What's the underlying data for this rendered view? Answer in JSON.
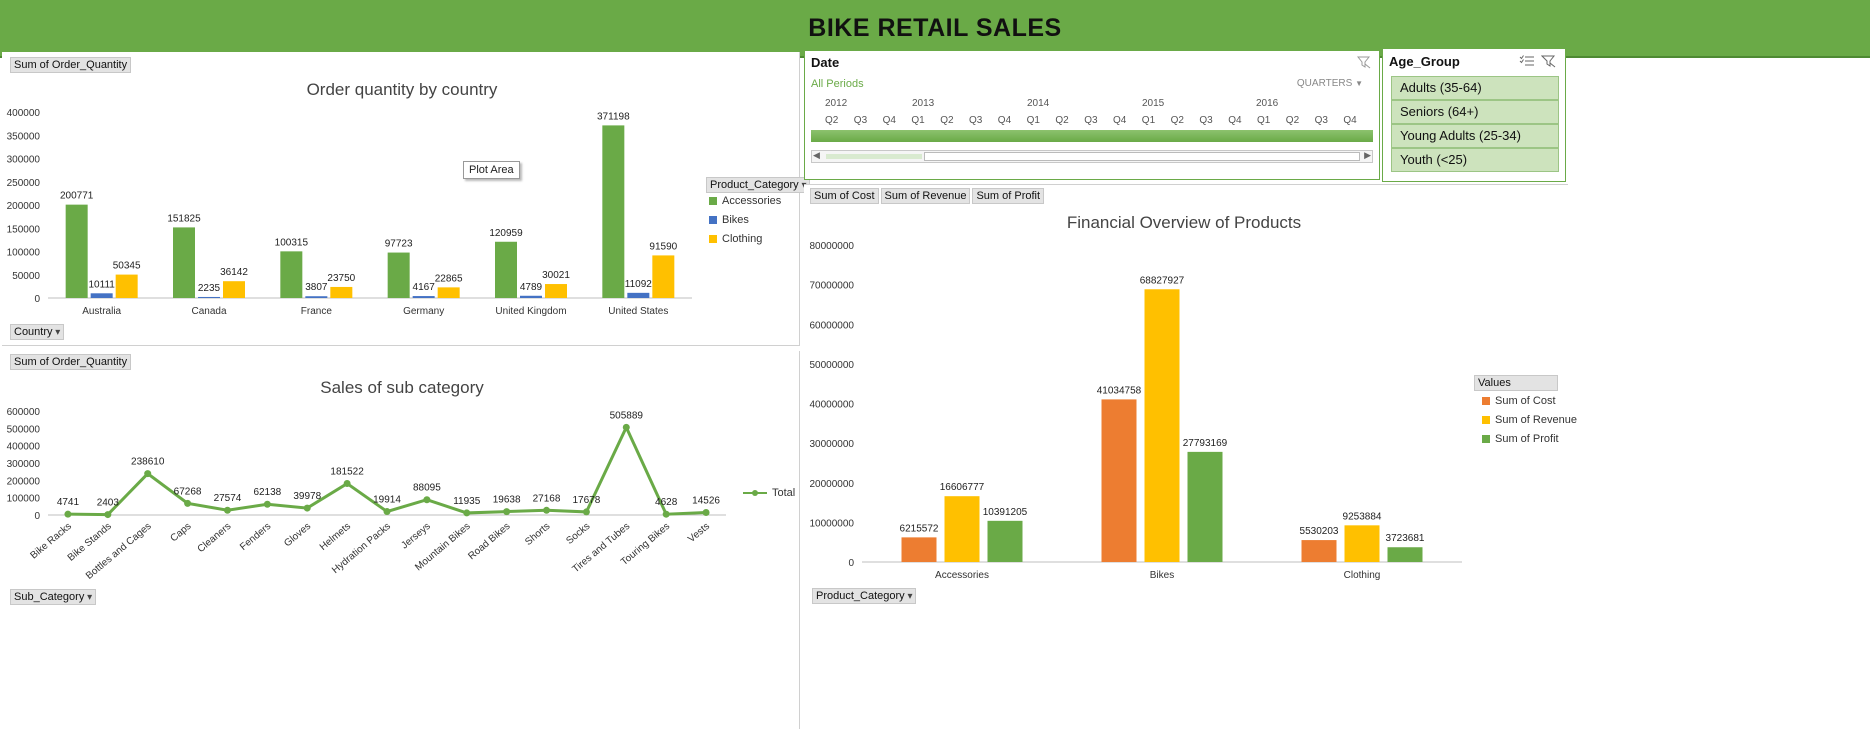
{
  "header": {
    "title": "BIKE RETAIL SALES"
  },
  "colors": {
    "green": "#6aaa47",
    "blue": "#4472c4",
    "yellow": "#ffc000",
    "orange": "#ed7d31"
  },
  "country_chart": {
    "field_chip": "Sum of Order_Quantity",
    "axis_chip": "Country",
    "legend_chip": "Product_Category",
    "tooltip": "Plot Area"
  },
  "subcat_chart": {
    "field_chip": "Sum of Order_Quantity",
    "axis_chip": "Sub_Category"
  },
  "finance_chart": {
    "chips": [
      "Sum of Cost",
      "Sum of Revenue",
      "Sum of Profit"
    ],
    "axis_chip": "Product_Category",
    "legend_chip": "Values"
  },
  "date_slicer": {
    "title": "Date",
    "all_periods": "All Periods",
    "level": "QUARTERS",
    "years": [
      "2012",
      "2013",
      "2014",
      "2015",
      "2016"
    ],
    "quarters": [
      "Q2",
      "Q3",
      "Q4",
      "Q1",
      "Q2",
      "Q3",
      "Q4",
      "Q1",
      "Q2",
      "Q3",
      "Q4",
      "Q1",
      "Q2",
      "Q3",
      "Q4",
      "Q1",
      "Q2",
      "Q3",
      "Q4"
    ]
  },
  "age_slicer": {
    "title": "Age_Group",
    "items": [
      "Adults (35-64)",
      "Seniors (64+)",
      "Young Adults (25-34)",
      "Youth (<25)"
    ]
  },
  "chart_data": [
    {
      "type": "bar",
      "title": "Order quantity by country",
      "categories": [
        "Australia",
        "Canada",
        "France",
        "Germany",
        "United Kingdom",
        "United States"
      ],
      "series": [
        {
          "name": "Accessories",
          "color": "#6aaa47",
          "values": [
            200771,
            151825,
            100315,
            97723,
            120959,
            371198
          ]
        },
        {
          "name": "Bikes",
          "color": "#4472c4",
          "values": [
            10111,
            2235,
            3807,
            4167,
            4789,
            11092
          ]
        },
        {
          "name": "Clothing",
          "color": "#ffc000",
          "values": [
            50345,
            36142,
            23750,
            22865,
            30021,
            91590
          ]
        }
      ],
      "ylim": [
        0,
        400000
      ],
      "yticks": [
        0,
        50000,
        100000,
        150000,
        200000,
        250000,
        300000,
        350000,
        400000
      ],
      "legend": "right",
      "grid": false
    },
    {
      "type": "line",
      "title": "Sales of sub category",
      "categories": [
        "Bike Racks",
        "Bike Stands",
        "Bottles and Cages",
        "Caps",
        "Cleaners",
        "Fenders",
        "Gloves",
        "Helmets",
        "Hydration Packs",
        "Jerseys",
        "Mountain Bikes",
        "Road Bikes",
        "Shorts",
        "Socks",
        "Tires and Tubes",
        "Touring Bikes",
        "Vests"
      ],
      "series": [
        {
          "name": "Total",
          "color": "#6aaa47",
          "values": [
            4741,
            2403,
            238610,
            67268,
            27574,
            62138,
            39978,
            181522,
            19914,
            88095,
            11935,
            19638,
            27168,
            17678,
            505889,
            4628,
            14526
          ]
        }
      ],
      "ylim": [
        0,
        600000
      ],
      "yticks": [
        0,
        100000,
        200000,
        300000,
        400000,
        500000,
        600000
      ],
      "legend": "right",
      "grid": false
    },
    {
      "type": "bar",
      "title": "Financial Overview of Products",
      "categories": [
        "Accessories",
        "Bikes",
        "Clothing"
      ],
      "series": [
        {
          "name": "Sum of Cost",
          "color": "#ed7d31",
          "values": [
            6215572,
            41034758,
            5530203
          ]
        },
        {
          "name": "Sum of Revenue",
          "color": "#ffc000",
          "values": [
            16606777,
            68827927,
            9253884
          ]
        },
        {
          "name": "Sum of Profit",
          "color": "#6aaa47",
          "values": [
            10391205,
            27793169,
            3723681
          ]
        }
      ],
      "ylim": [
        0,
        80000000
      ],
      "yticks": [
        0,
        10000000,
        20000000,
        30000000,
        40000000,
        50000000,
        60000000,
        70000000,
        80000000
      ],
      "legend": "right",
      "grid": false
    }
  ]
}
